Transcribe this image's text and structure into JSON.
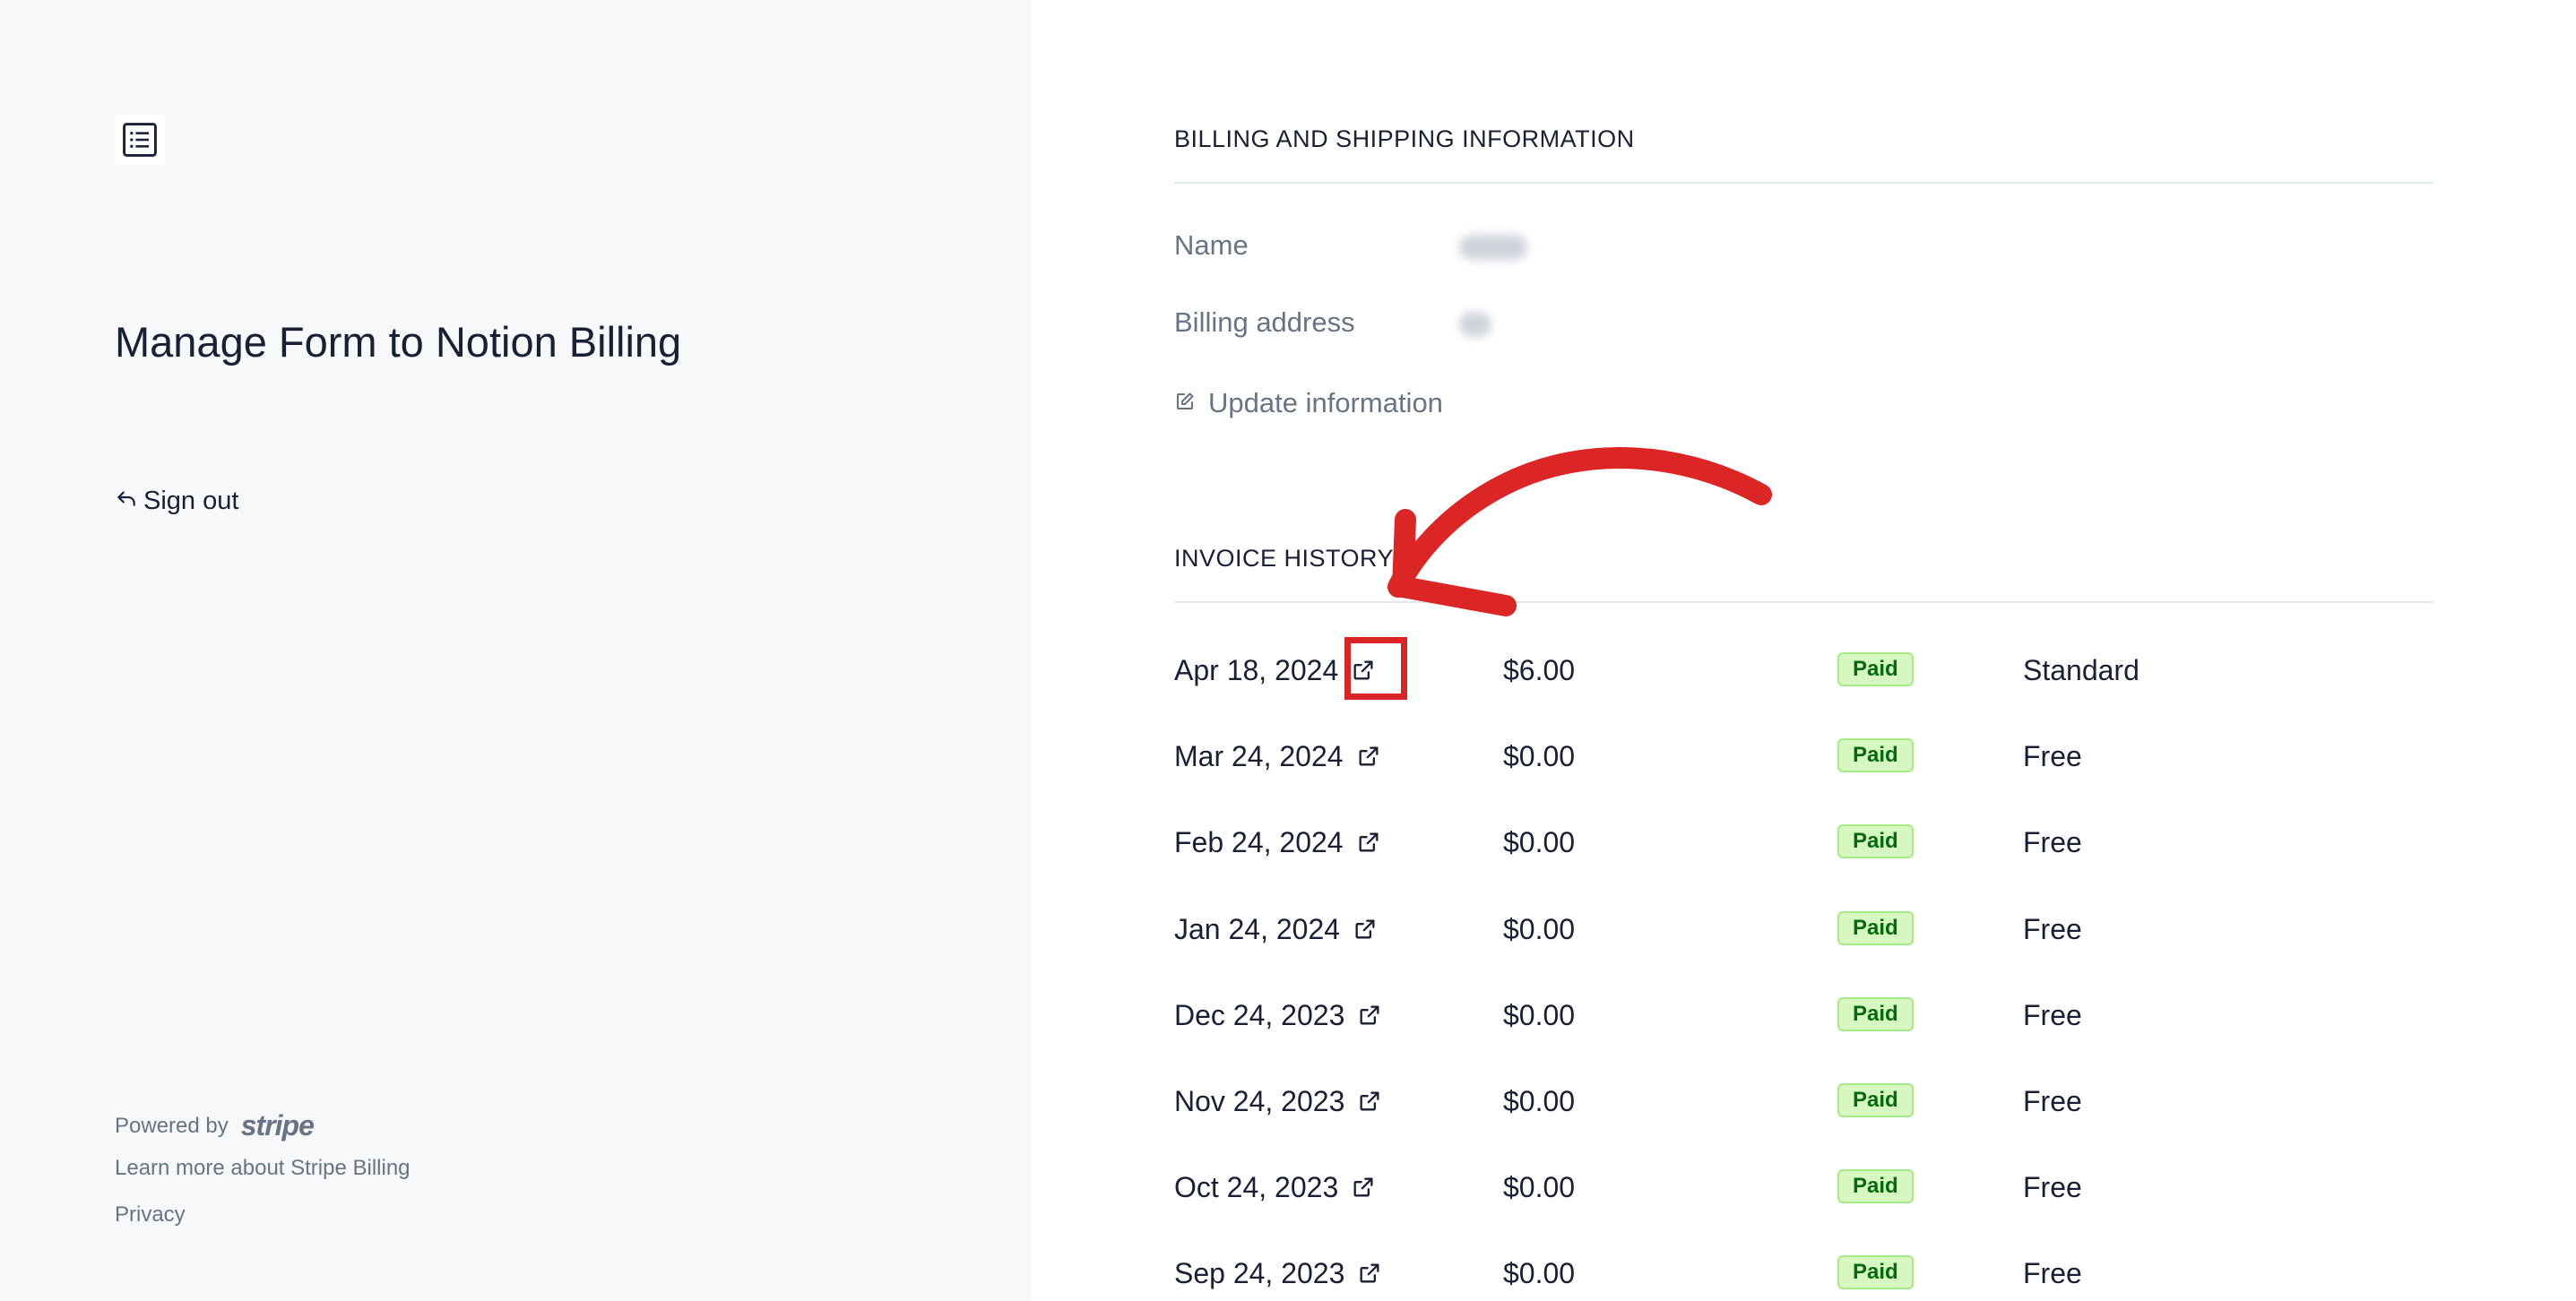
{
  "left": {
    "title": "Manage Form to Notion Billing",
    "sign_out": "Sign out",
    "powered_by": "Powered by",
    "stripe": "stripe",
    "learn_more": "Learn more about Stripe Billing",
    "privacy": "Privacy"
  },
  "billing": {
    "heading": "BILLING AND SHIPPING INFORMATION",
    "name_label": "Name",
    "address_label": "Billing address",
    "update": "Update information"
  },
  "invoices": {
    "heading": "INVOICE HISTORY",
    "rows": [
      {
        "date": "Apr 18, 2024",
        "amount": "$6.00",
        "status": "Paid",
        "plan": "Standard"
      },
      {
        "date": "Mar 24, 2024",
        "amount": "$0.00",
        "status": "Paid",
        "plan": "Free"
      },
      {
        "date": "Feb 24, 2024",
        "amount": "$0.00",
        "status": "Paid",
        "plan": "Free"
      },
      {
        "date": "Jan 24, 2024",
        "amount": "$0.00",
        "status": "Paid",
        "plan": "Free"
      },
      {
        "date": "Dec 24, 2023",
        "amount": "$0.00",
        "status": "Paid",
        "plan": "Free"
      },
      {
        "date": "Nov 24, 2023",
        "amount": "$0.00",
        "status": "Paid",
        "plan": "Free"
      },
      {
        "date": "Oct 24, 2023",
        "amount": "$0.00",
        "status": "Paid",
        "plan": "Free"
      },
      {
        "date": "Sep 24, 2023",
        "amount": "$0.00",
        "status": "Paid",
        "plan": "Free"
      }
    ]
  },
  "colors": {
    "left_bg": "#f6f8fa",
    "text": "#1a1f36",
    "muted": "#697386",
    "badge_bg": "#d7f7c2",
    "badge_text": "#05690d",
    "annotation": "#dc2626"
  },
  "icons": [
    "document-list-icon",
    "sign-out-arrow-icon",
    "edit-icon",
    "external-link-icon"
  ]
}
